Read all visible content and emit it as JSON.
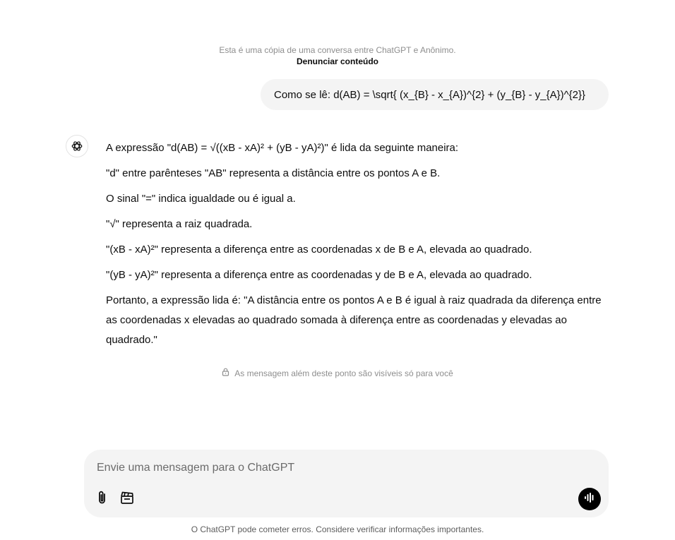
{
  "header_notice": {
    "text": "Esta é uma cópia de uma conversa entre ChatGPT e Anônimo.",
    "report_link": "Denunciar conteúdo"
  },
  "conversation": {
    "user_message": "Como se lê: d(AB) = \\sqrt{ (x_{B} - x_{A})^{2} + (y_{B} - y_{A})^{2}}",
    "assistant_paragraphs": [
      "A expressão \"d(AB) = √((xB - xA)² + (yB - yA)²)\" é lida da seguinte maneira:",
      "\"d\" entre parênteses \"AB\" representa a distância entre os pontos A e B.",
      "O sinal \"=\" indica igualdade ou é igual a.",
      "\"√\" representa a raiz quadrada.",
      "\"(xB - xA)²\" representa a diferença entre as coordenadas x de B e A, elevada ao quadrado.",
      "\"(yB - yA)²\" representa a diferença entre as coordenadas y de B e A, elevada ao quadrado.",
      "Portanto, a expressão lida é: \"A distância entre os pontos A e B é igual à raiz quadrada da diferença entre as coordenadas x elevadas ao quadrado somada à diferença entre as coordenadas y elevadas ao quadrado.\""
    ]
  },
  "visibility_note": "As mensagem além deste ponto são visíveis só para você",
  "composer": {
    "placeholder": "Envie uma mensagem para o ChatGPT",
    "attach_icon": "paperclip-icon",
    "tools_icon": "clapperboard-icon",
    "voice_icon": "voice-waveform-icon"
  },
  "footer": {
    "disclaimer": "O ChatGPT pode cometer erros. Considere verificar informações importantes."
  }
}
